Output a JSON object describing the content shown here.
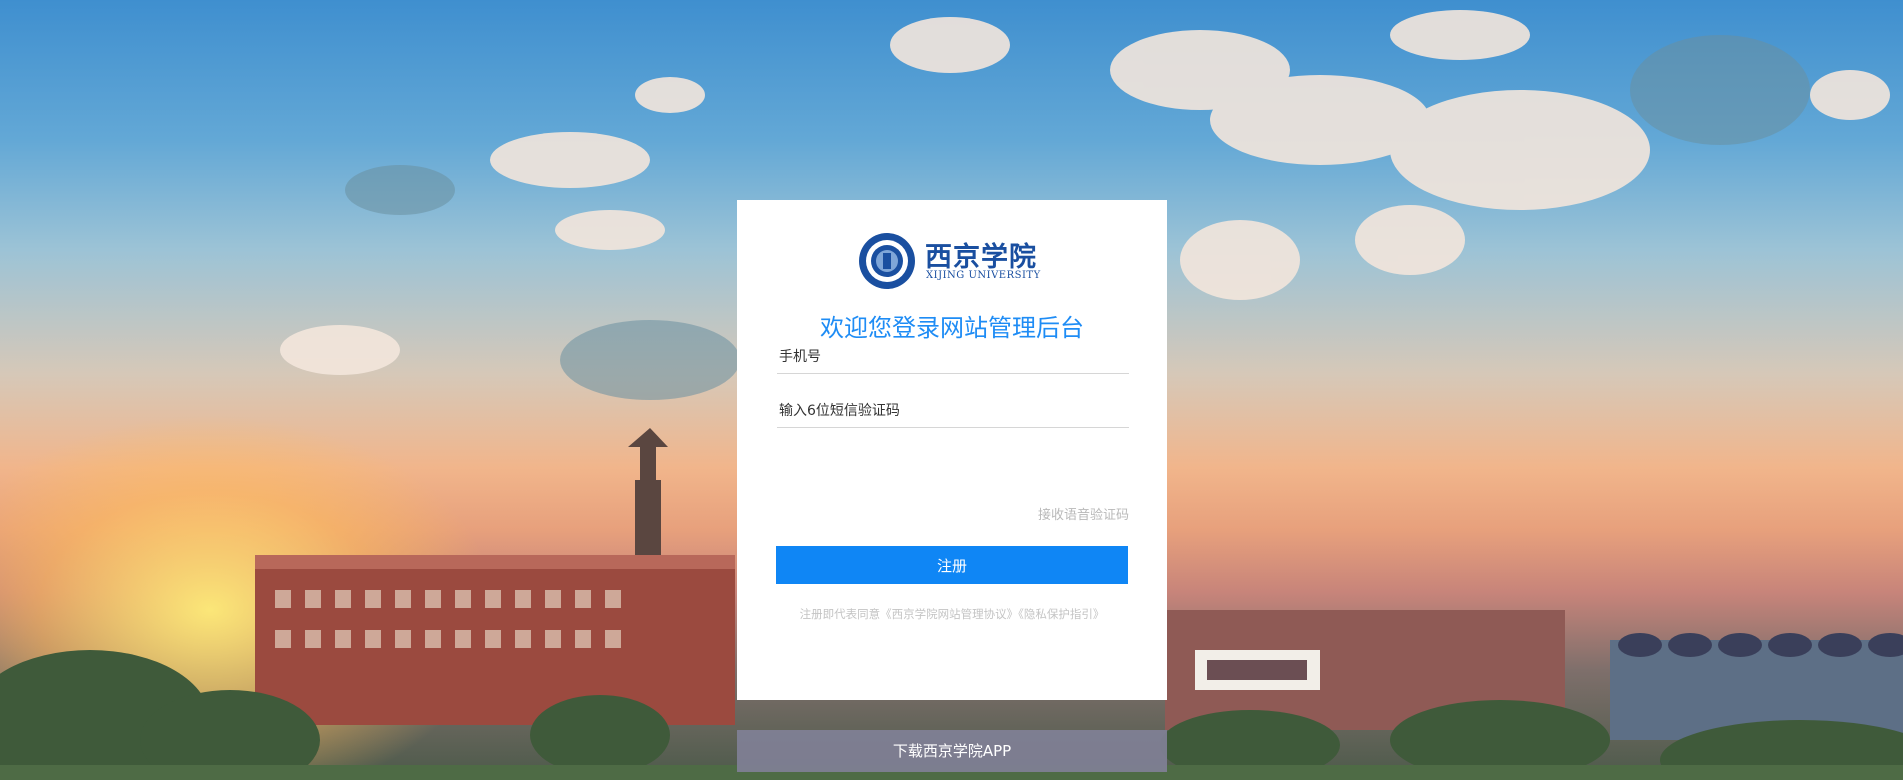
{
  "logo": {
    "name_cn": "西京学院",
    "name_en": "XIJING UNIVERSITY",
    "seal_ring_text": "西京学院 · XIJING UNIVERSITY"
  },
  "title": "欢迎您登录网站管理后台",
  "form": {
    "phone_placeholder": "手机号",
    "code_placeholder": "输入6位短信验证码",
    "voice_code_link": "接收语音验证码",
    "submit_label": "注册"
  },
  "agreement": {
    "prefix": "注册即代表同意",
    "terms_link": "《西京学院网站管理协议》",
    "privacy_link": "《隐私保护指引》"
  },
  "download_app_label": "下载西京学院APP",
  "colors": {
    "accent": "#0f86f5",
    "title": "#1e8cf5",
    "logo_blue": "#1a4fa0",
    "download_bar": "#80809a"
  },
  "icons": [
    "university-seal-icon"
  ]
}
